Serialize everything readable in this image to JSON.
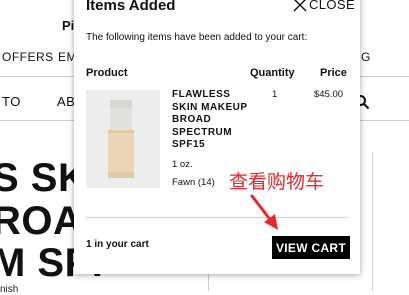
{
  "background": {
    "nav_row1_left": "OFFERS",
    "nav_row1_mid": "EM",
    "nav_row1_right": "G",
    "nav_row0_left": "Pi",
    "nav_row2_left": "TO",
    "nav_row2_mid": "AB",
    "big_line1": "S SKI",
    "big_line2": "ROA",
    "big_line3": "M SPF",
    "finish_text": "nish"
  },
  "popup": {
    "title": "Items Added",
    "close_label": "CLOSE",
    "intro": "The following items have been added to your cart:",
    "headers": {
      "product": "Product",
      "quantity": "Quantity",
      "price": "Price"
    },
    "item": {
      "name": "FLAWLESS SKIN MAKEUP BROAD SPECTRUM SPF15",
      "size": "1 oz.",
      "shade": "Fawn (14)",
      "quantity": "1",
      "price": "$45.00"
    },
    "cart_count": "1 in your cart",
    "view_cart_label": "VIEW CART"
  },
  "annotation": {
    "text": "查看购物车",
    "color": "#e8282a"
  },
  "colors": {
    "button_bg": "#000000",
    "button_text": "#ffffff",
    "divider": "#cfcfcf"
  },
  "icons": [
    "close-icon",
    "search-icon",
    "arrow-icon"
  ]
}
